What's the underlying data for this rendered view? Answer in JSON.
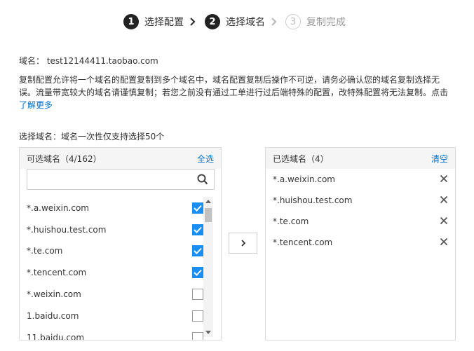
{
  "steps": [
    {
      "num": "1",
      "label": "选择配置"
    },
    {
      "num": "2",
      "label": "选择域名"
    },
    {
      "num": "3",
      "label": "复制完成"
    }
  ],
  "domain_label": "域名：",
  "domain_value": "test12144411.taobao.com",
  "description": "复制配置允许将一个域名的配置复制到多个域名中，域名配置复制后操作不可逆，请务必确认您的域名复制选择无误。流量带宽较大的域名请谨慎复制；若您之前没有通过工单进行过后端特殊的配置，改特殊配置将无法复制。点击",
  "learn_more": "了解更多",
  "select_tip": "选择域名：域名一次性仅支持选择50个",
  "left_panel": {
    "title": "可选域名（4/162）",
    "select_all": "全选",
    "search_placeholder": "",
    "items": [
      {
        "name": "*.a.weixin.com",
        "checked": true
      },
      {
        "name": "*.huishou.test.com",
        "checked": true
      },
      {
        "name": "*.te.com",
        "checked": true
      },
      {
        "name": "*.tencent.com",
        "checked": true
      },
      {
        "name": "*.weixin.com",
        "checked": false
      },
      {
        "name": "1.baidu.com",
        "checked": false
      },
      {
        "name": "11.baidu.com",
        "checked": false
      }
    ]
  },
  "right_panel": {
    "title": "已选域名（4）",
    "clear": "清空",
    "items": [
      {
        "name": "*.a.weixin.com"
      },
      {
        "name": "*.huishou.test.com"
      },
      {
        "name": "*.te.com"
      },
      {
        "name": "*.tencent.com"
      }
    ]
  },
  "colors": {
    "accent": "#1a8ef2",
    "link": "#0070cc"
  }
}
